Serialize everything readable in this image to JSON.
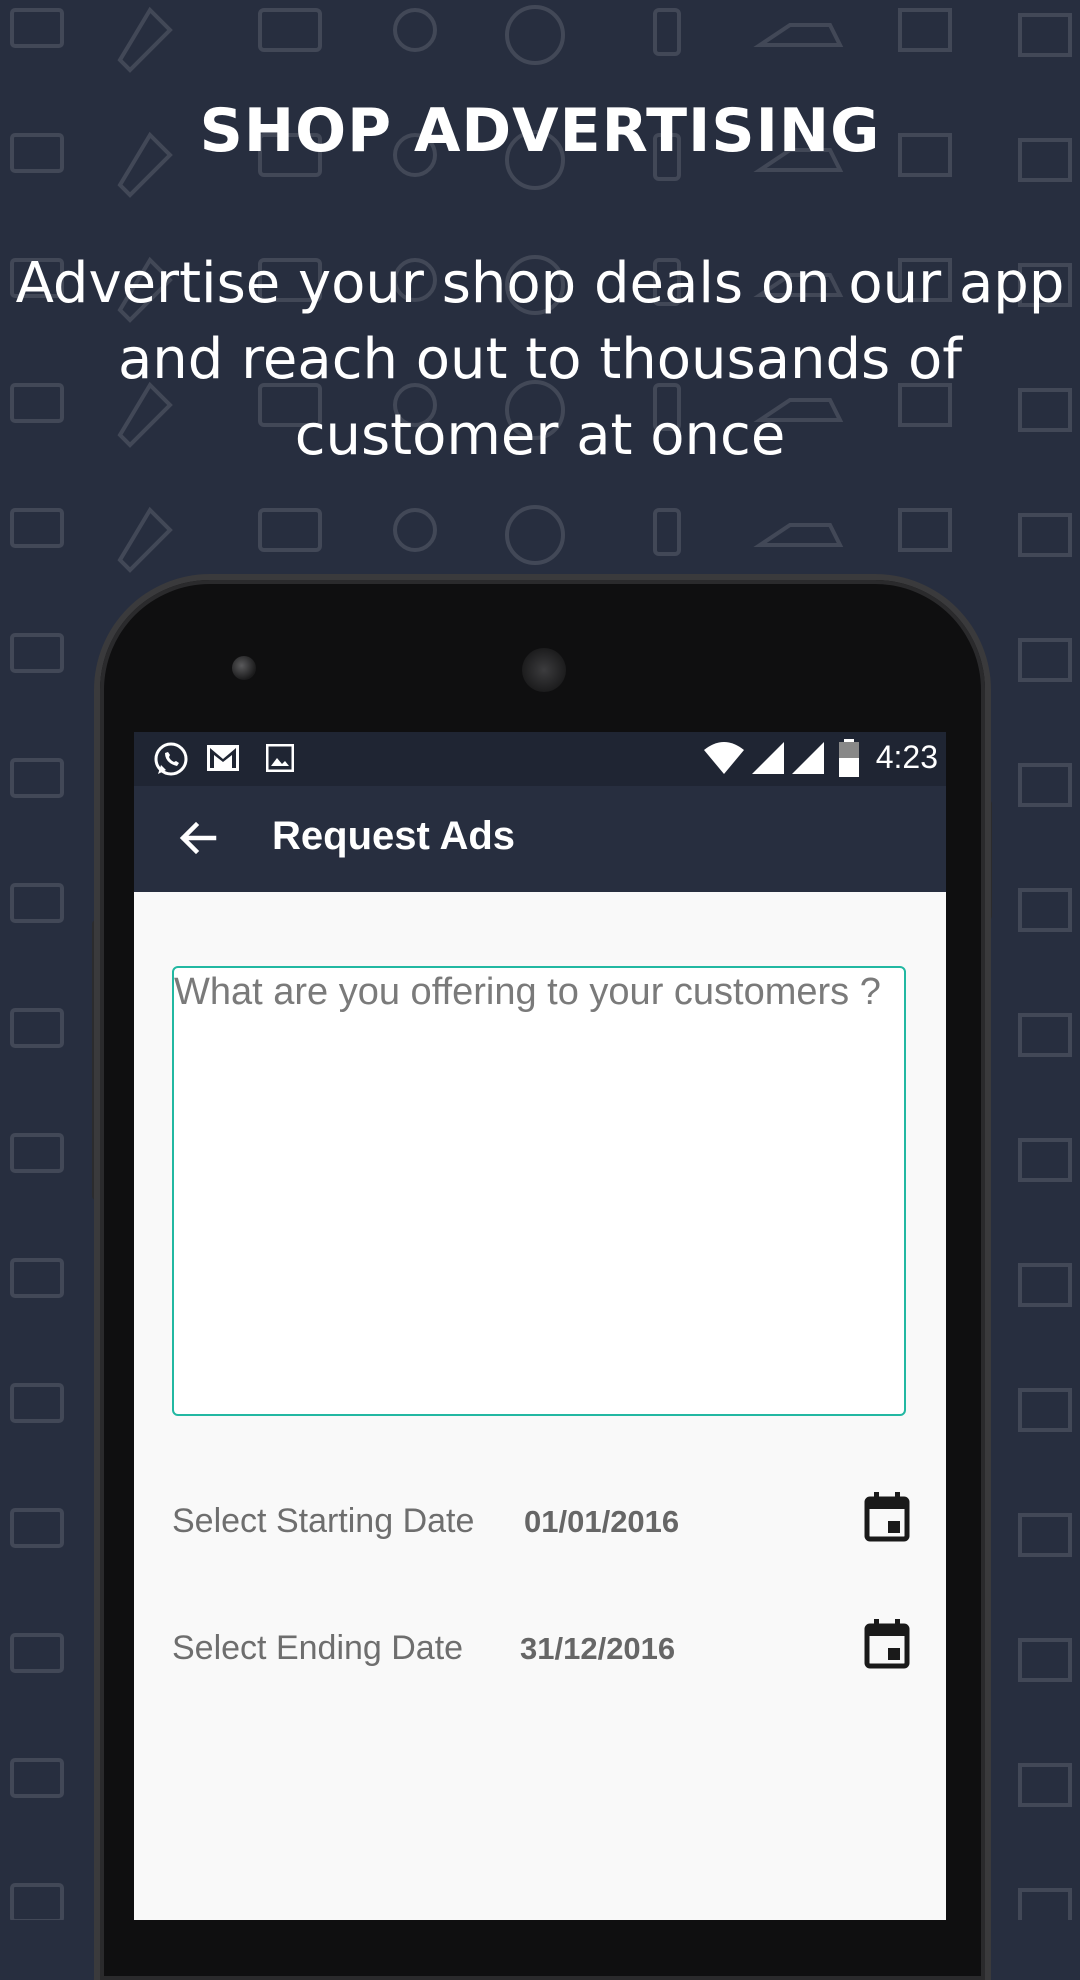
{
  "banner": {
    "title": "SHOP ADVERTISING",
    "subtitle": "Advertise your shop deals on our app and reach out to thousands of customer at once"
  },
  "statusbar": {
    "time": "4:23",
    "left_icons": [
      "whatsapp-icon",
      "gmail-icon",
      "image-icon"
    ],
    "right_icons": [
      "wifi-icon",
      "signal-icon",
      "signal-icon",
      "battery-icon"
    ]
  },
  "appbar": {
    "title": "Request Ads",
    "back_icon": "arrow-back-icon"
  },
  "form": {
    "offer_placeholder": "What are you offering to your customers ?",
    "offer_value": "",
    "start_label": "Select Starting Date",
    "start_value": "01/01/2016",
    "end_label": "Select Ending Date",
    "end_value": "31/12/2016",
    "calendar_icon": "calendar-icon"
  },
  "colors": {
    "background": "#272e3f",
    "statusbar": "#1f2533",
    "accent": "#22b8a2",
    "screen": "#f9f9f9"
  }
}
